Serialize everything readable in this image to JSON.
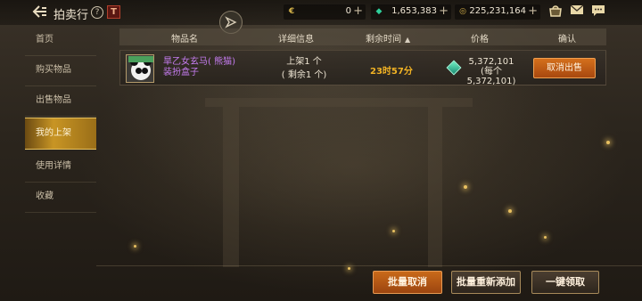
{
  "header": {
    "title": "拍卖行",
    "help_icon": "?",
    "badge_icon": "T"
  },
  "currencies": [
    {
      "icon": "€",
      "value": "0",
      "color": "#d6b44a"
    },
    {
      "icon": "◆",
      "value": "1,653,383",
      "color": "#2fcf9b"
    },
    {
      "icon": "◎",
      "value": "225,231,164",
      "color": "#d7b24a"
    }
  ],
  "sidebar": {
    "items": [
      {
        "label": "首页"
      },
      {
        "label": "购买物品"
      },
      {
        "label": "出售物品"
      },
      {
        "label": "我的上架"
      },
      {
        "label": "使用详情"
      },
      {
        "label": "收藏"
      }
    ],
    "active_index": 3
  },
  "table": {
    "headers": {
      "name": "物品名",
      "detail": "详细信息",
      "remaining": "剩余时间",
      "sort_arrow": "▲",
      "price": "价格",
      "confirm": "确认"
    },
    "rows": [
      {
        "name_line1": "旱乙女玄马( 熊猫)",
        "name_line2": "装扮盒子",
        "detail_line1": "上架1 个",
        "detail_line2": "( 剩余1 个)",
        "remaining": "23时57分",
        "price": "5,372,101",
        "unit_price": "(每个5,372,101)",
        "action": "取消出售"
      }
    ]
  },
  "footer": {
    "batch_cancel": "批量取消",
    "batch_relist": "批量重新添加",
    "claim_all": "一键领取"
  },
  "colors": {
    "accent": "#c89524",
    "item_name": "#c57cf0",
    "remaining": "#f2b324",
    "button": "#c96a1a"
  }
}
